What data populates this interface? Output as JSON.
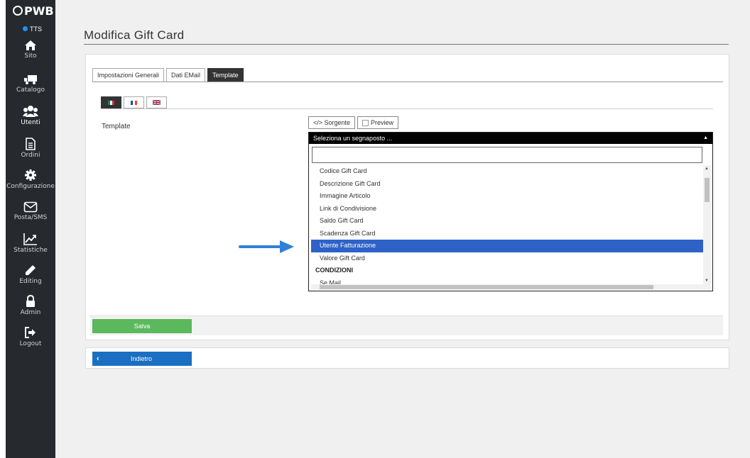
{
  "sidebar": {
    "logo_text": "PWB",
    "site_tag": "TTS",
    "items": [
      {
        "label": "Sito",
        "icon": "home-icon"
      },
      {
        "label": "Catalogo",
        "icon": "truck-icon"
      },
      {
        "label": "Utenti",
        "icon": "users-icon"
      },
      {
        "label": "Ordini",
        "icon": "document-icon"
      },
      {
        "label": "Configurazione",
        "icon": "gear-icon"
      },
      {
        "label": "Posta/SMS",
        "icon": "envelope-icon"
      },
      {
        "label": "Statistiche",
        "icon": "chart-icon"
      },
      {
        "label": "Editing",
        "icon": "pencil-icon"
      },
      {
        "label": "Admin",
        "icon": "lock-icon"
      },
      {
        "label": "Logout",
        "icon": "logout-icon"
      }
    ],
    "active": "Utenti"
  },
  "page": {
    "title": "Modifica Gift Card"
  },
  "tabs": [
    {
      "label": "Impostazioni Generali",
      "active": false
    },
    {
      "label": "Dati EMail",
      "active": false
    },
    {
      "label": "Template",
      "active": true
    }
  ],
  "languages": [
    {
      "code": "it",
      "active": true
    },
    {
      "code": "fr",
      "active": false
    },
    {
      "code": "en",
      "active": false
    }
  ],
  "template": {
    "label": "Template",
    "source_button": "</> Sorgente",
    "preview_button": "Preview"
  },
  "dropdown": {
    "header": "Seleziona un segnaposto ...",
    "search_value": "",
    "items": [
      {
        "label": "Codice Gift Card",
        "type": "option",
        "selected": false
      },
      {
        "label": "Descrizione Gift Card",
        "type": "option",
        "selected": false
      },
      {
        "label": "Immagine Articolo",
        "type": "option",
        "selected": false
      },
      {
        "label": "Link di Condivisione",
        "type": "option",
        "selected": false
      },
      {
        "label": "Saldo Gift Card",
        "type": "option",
        "selected": false
      },
      {
        "label": "Scadenza Gift Card",
        "type": "option",
        "selected": false
      },
      {
        "label": "Utente Fatturazione",
        "type": "option",
        "selected": true
      },
      {
        "label": "Valore Gift Card",
        "type": "option",
        "selected": false
      },
      {
        "label": "CONDIZIONI",
        "type": "group",
        "selected": false
      },
      {
        "label": "Se Mail",
        "type": "option",
        "selected": false
      }
    ]
  },
  "actions": {
    "save_label": "Salva",
    "back_label": "Indietro"
  },
  "colors": {
    "sidebar_bg": "#262a2e",
    "selected_option": "#2e62c7",
    "save_button": "#5cb85c",
    "back_button": "#1a6fc2",
    "arrow": "#2f80d8",
    "status_dot": "#1e90ff"
  }
}
